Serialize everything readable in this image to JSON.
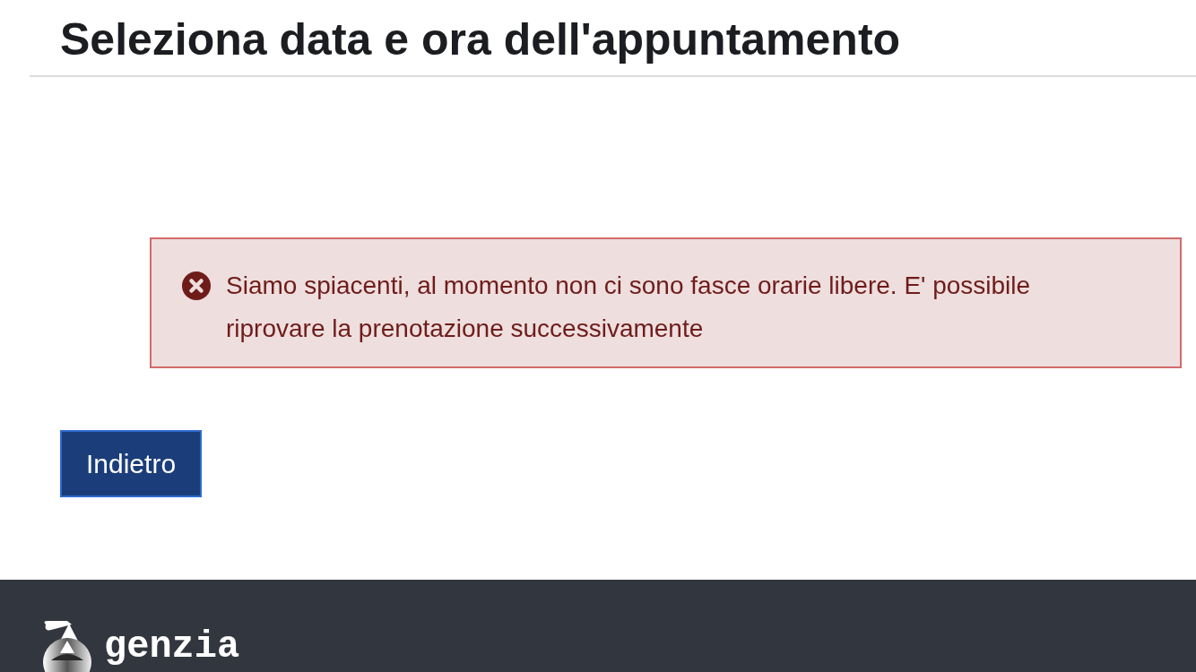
{
  "page_title": "Seleziona data e ora dell'appuntamento",
  "alert": {
    "kind": "error",
    "message": "Siamo spiacenti, al momento non ci sono fasce orarie libere. E' possibile riprovare la prenotazione successivamente"
  },
  "buttons": [
    {
      "label": "Indietro"
    }
  ],
  "footer": {
    "logo_text": "genzia"
  }
}
